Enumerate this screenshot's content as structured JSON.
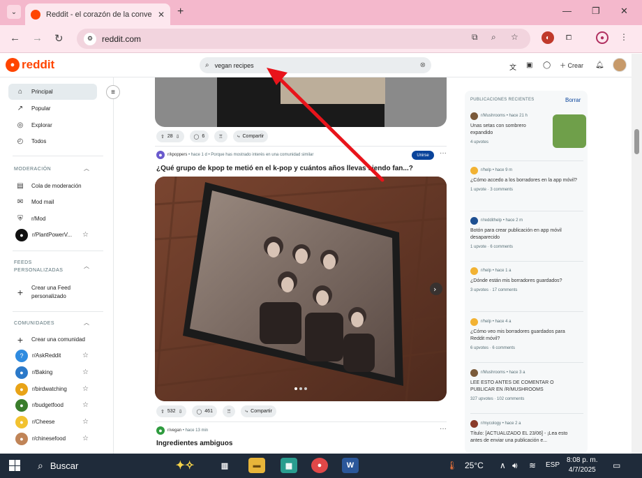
{
  "browser": {
    "tab_title": "Reddit - el corazón de la conve",
    "url": "reddit.com"
  },
  "reddit": {
    "logo_text": "reddit",
    "search_query": "vegan recipes",
    "create_label": "Crear"
  },
  "sidebar": {
    "main": [
      {
        "label": "Principal",
        "icon": "home-icon"
      },
      {
        "label": "Popular",
        "icon": "popular-icon"
      },
      {
        "label": "Explorar",
        "icon": "explore-icon"
      },
      {
        "label": "Todos",
        "icon": "all-icon"
      }
    ],
    "moderation_header": "MODERACIÓN",
    "moderation": [
      {
        "label": "Cola de moderación"
      },
      {
        "label": "Mod mail"
      },
      {
        "label": "r/Mod"
      },
      {
        "label": "r/PlantPowerV..."
      }
    ],
    "feeds_header_1": "FEEDS",
    "feeds_header_2": "PERSONALIZADAS",
    "create_feed_1": "Crear una Feed",
    "create_feed_2": "personalizado",
    "communities_header": "COMUNIDADES",
    "create_community": "Crear una comunidad",
    "communities": [
      {
        "label": "r/AskReddit",
        "color": "#2e8be0"
      },
      {
        "label": "r/Baking",
        "color": "#2b79c9"
      },
      {
        "label": "r/birdwatching",
        "color": "#e8a317"
      },
      {
        "label": "r/budgetfood",
        "color": "#3a7d2b"
      },
      {
        "label": "r/Cheese",
        "color": "#f2c230"
      },
      {
        "label": "r/chinesefood",
        "color": "#c08457"
      }
    ]
  },
  "feed": {
    "post1": {
      "votes": "28",
      "comments": "6",
      "share": "Compartir"
    },
    "post2": {
      "subreddit": "r/kpoppers",
      "meta": "• hace 1 d • Porque has mostrado interés en una comunidad similar",
      "join": "Unirse",
      "title": "¿Qué grupo de kpop te metió en el k-pop y cuántos años llevas siendo fan...?",
      "votes": "532",
      "comments": "461",
      "share": "Compartir"
    },
    "post3": {
      "subreddit": "r/vegan",
      "meta": "• hace 13 min",
      "title": "Ingredientes ambiguos"
    }
  },
  "recent": {
    "header": "PUBLICACIONES RECIENTES",
    "clear": "Borrar",
    "items": [
      {
        "sub": "r/Mushrooms",
        "time": "• hace 21 h",
        "title": "Unas setas con sombrero expandido",
        "stats": "4 upvotes",
        "color": "#7a5a3a"
      },
      {
        "sub": "r/help",
        "time": "• hace 9 m",
        "title": "¿Cómo accedo a los borradores en la app móvil?",
        "stats": "1 upvote · 3 comments",
        "color": "#f2b233"
      },
      {
        "sub": "r/reddithelp",
        "time": "• hace 2 m",
        "title": "Botón para crear publicación en app móvil desaparecido",
        "stats": "1 upvote · 6 comments",
        "color": "#1d4f91"
      },
      {
        "sub": "r/help",
        "time": "• hace 1 a",
        "title": "¿Dónde están mis borradores guardados?",
        "stats": "3 upvotes · 17 comments",
        "color": "#f2b233"
      },
      {
        "sub": "r/help",
        "time": "• hace 4 a",
        "title": "¿Cómo veo mis borradores guardados para Reddit móvil?",
        "stats": "6 upvotes · 6 comments",
        "color": "#f2b233"
      },
      {
        "sub": "r/Mushrooms",
        "time": "• hace 3 a",
        "title": "LEE ESTO ANTES DE COMENTAR O PUBLICAR EN /R/MUSHROOMS",
        "stats": "327 upvotes · 102 comments",
        "color": "#7a5a3a"
      },
      {
        "sub": "r/mycology",
        "time": "• hace 2 a",
        "title": "Título: [ACTUALIZADO EL 23/06] - ¡Lea esto antes de enviar una publicación e...",
        "stats": "",
        "color": "#8a3b2a"
      }
    ]
  },
  "taskbar": {
    "search": "Buscar",
    "temp": "25°C",
    "lang": "ESP",
    "time": "8:08 p. m.",
    "date": "4/7/2025"
  }
}
